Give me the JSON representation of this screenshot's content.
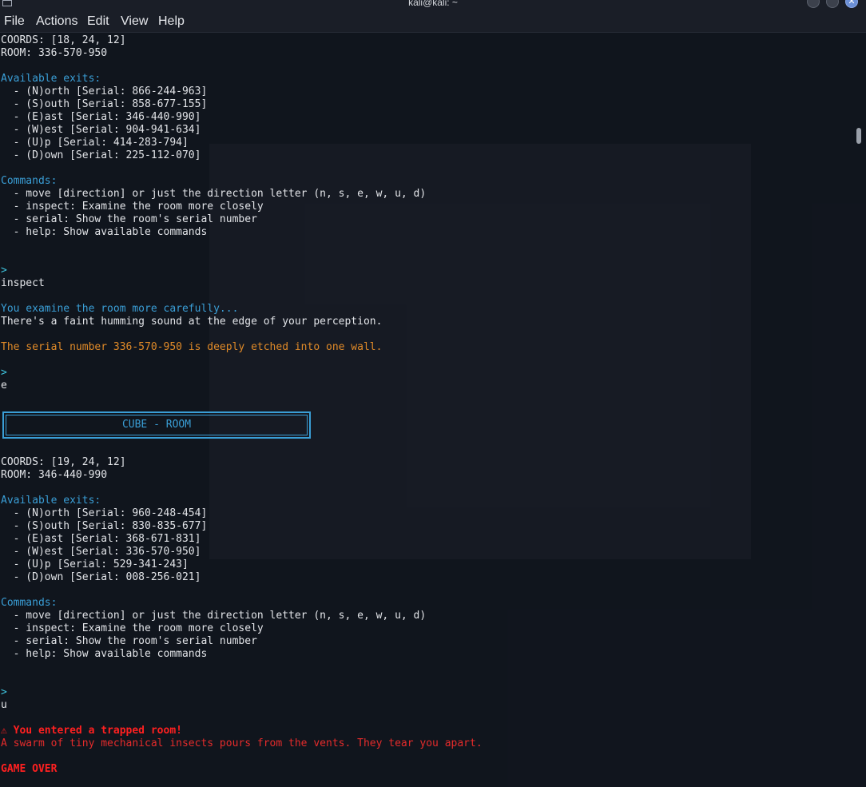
{
  "window": {
    "title": "kali@kali: ~",
    "controls": [
      "minimize-icon",
      "maximize-icon",
      "close-icon"
    ]
  },
  "menu": [
    "File",
    "Actions",
    "Edit",
    "View",
    "Help"
  ],
  "cube_box": {
    "title": "CUBE - ROOM"
  },
  "lines": [
    {
      "text": "COORDS: [18, 24, 12]",
      "style": "normal"
    },
    {
      "text": "ROOM: 336-570-950",
      "style": "normal"
    },
    {
      "text": "",
      "style": "normal"
    },
    {
      "text": "Available exits:",
      "style": "blue"
    },
    {
      "text": "  - (N)orth [Serial: 866-244-963]",
      "style": "normal"
    },
    {
      "text": "  - (S)outh [Serial: 858-677-155]",
      "style": "normal"
    },
    {
      "text": "  - (E)ast [Serial: 346-440-990]",
      "style": "normal"
    },
    {
      "text": "  - (W)est [Serial: 904-941-634]",
      "style": "normal"
    },
    {
      "text": "  - (U)p [Serial: 414-283-794]",
      "style": "normal"
    },
    {
      "text": "  - (D)own [Serial: 225-112-070]",
      "style": "normal"
    },
    {
      "text": "",
      "style": "normal"
    },
    {
      "text": "Commands:",
      "style": "blue"
    },
    {
      "text": "  - move [direction] or just the direction letter (n, s, e, w, u, d)",
      "style": "normal"
    },
    {
      "text": "  - inspect: Examine the room more closely",
      "style": "normal"
    },
    {
      "text": "  - serial: Show the room's serial number",
      "style": "normal"
    },
    {
      "text": "  - help: Show available commands",
      "style": "normal"
    },
    {
      "text": "",
      "style": "normal"
    },
    {
      "text": "",
      "style": "normal"
    },
    {
      "text": ">",
      "style": "cyan"
    },
    {
      "text": "inspect",
      "style": "normal"
    },
    {
      "text": "",
      "style": "normal"
    },
    {
      "text": "You examine the room more carefully...",
      "style": "blue"
    },
    {
      "text": "There's a faint humming sound at the edge of your perception.",
      "style": "normal"
    },
    {
      "text": "",
      "style": "normal"
    },
    {
      "text": "The serial number 336-570-950 is deeply etched into one wall.",
      "style": "orange"
    },
    {
      "text": "",
      "style": "normal"
    },
    {
      "text": ">",
      "style": "cyan"
    },
    {
      "text": "e",
      "style": "normal"
    },
    {
      "text": "",
      "style": "normal"
    },
    {
      "text": "",
      "style": "normal"
    },
    {
      "text": "",
      "style": "normal"
    },
    {
      "text": "",
      "style": "normal"
    },
    {
      "text": "",
      "style": "normal"
    },
    {
      "text": "COORDS: [19, 24, 12]",
      "style": "normal"
    },
    {
      "text": "ROOM: 346-440-990",
      "style": "normal"
    },
    {
      "text": "",
      "style": "normal"
    },
    {
      "text": "Available exits:",
      "style": "blue"
    },
    {
      "text": "  - (N)orth [Serial: 960-248-454]",
      "style": "normal"
    },
    {
      "text": "  - (S)outh [Serial: 830-835-677]",
      "style": "normal"
    },
    {
      "text": "  - (E)ast [Serial: 368-671-831]",
      "style": "normal"
    },
    {
      "text": "  - (W)est [Serial: 336-570-950]",
      "style": "normal"
    },
    {
      "text": "  - (U)p [Serial: 529-341-243]",
      "style": "normal"
    },
    {
      "text": "  - (D)own [Serial: 008-256-021]",
      "style": "normal"
    },
    {
      "text": "",
      "style": "normal"
    },
    {
      "text": "Commands:",
      "style": "blue"
    },
    {
      "text": "  - move [direction] or just the direction letter (n, s, e, w, u, d)",
      "style": "normal"
    },
    {
      "text": "  - inspect: Examine the room more closely",
      "style": "normal"
    },
    {
      "text": "  - serial: Show the room's serial number",
      "style": "normal"
    },
    {
      "text": "  - help: Show available commands",
      "style": "normal"
    },
    {
      "text": "",
      "style": "normal"
    },
    {
      "text": "",
      "style": "normal"
    },
    {
      "text": ">",
      "style": "cyan"
    },
    {
      "text": "u",
      "style": "normal"
    },
    {
      "text": "",
      "style": "normal"
    },
    {
      "text": "⚠ You entered a trapped room!",
      "style": "red-bold"
    },
    {
      "text": "A swarm of tiny mechanical insects pours from the vents. They tear you apart.",
      "style": "red"
    },
    {
      "text": "",
      "style": "normal"
    },
    {
      "text": "GAME OVER",
      "style": "red-bold"
    }
  ],
  "colors": {
    "blue": "#3a9ed6",
    "cyan": "#3fc6e0",
    "orange": "#e08a28",
    "red": "#e52b2b",
    "background": "#11151e"
  }
}
